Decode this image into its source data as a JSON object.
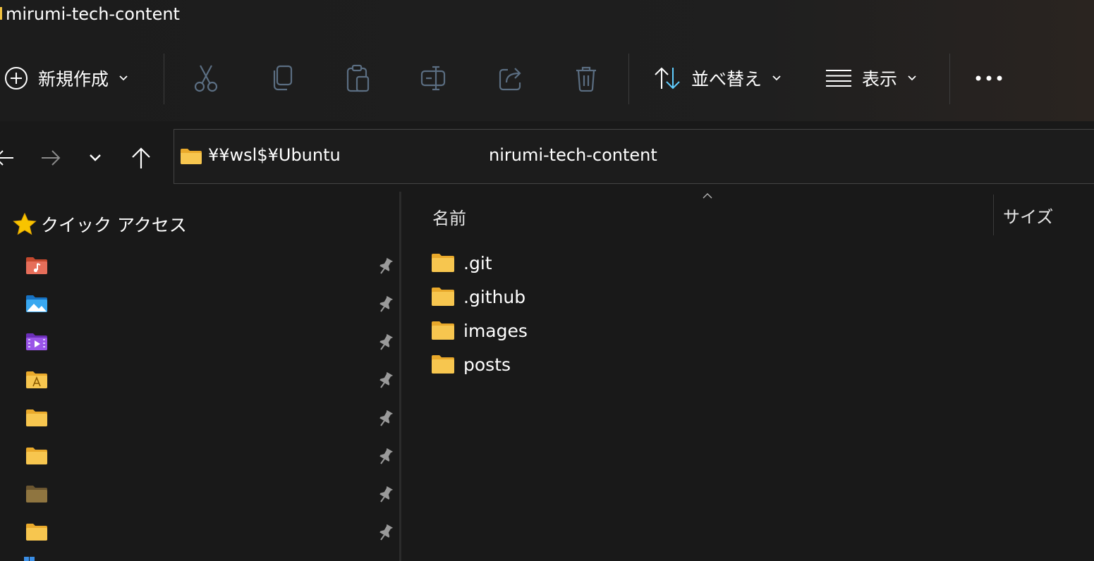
{
  "window": {
    "title": "mirumi-tech-content"
  },
  "toolbar": {
    "new_label": "新規作成",
    "sort_label": "並べ替え",
    "view_label": "表示",
    "icons": [
      "cut-icon",
      "copy-icon",
      "paste-icon",
      "rename-icon",
      "share-icon",
      "delete-icon"
    ]
  },
  "address": {
    "path": "¥¥wsl$¥Ubuntu",
    "current": "nirumi-tech-content"
  },
  "sidebar": {
    "quick_access_label": "クイック アクセス",
    "items": [
      {
        "icon": "music-folder-icon"
      },
      {
        "icon": "pictures-folder-icon"
      },
      {
        "icon": "videos-folder-icon"
      },
      {
        "icon": "font-folder-icon"
      },
      {
        "icon": "folder-icon"
      },
      {
        "icon": "folder-icon"
      },
      {
        "icon": "dark-folder-icon"
      },
      {
        "icon": "folder-icon"
      }
    ]
  },
  "list": {
    "columns": {
      "name": "名前",
      "size": "サイズ"
    },
    "rows": [
      {
        "name": ".git"
      },
      {
        "name": ".github"
      },
      {
        "name": "images"
      },
      {
        "name": "posts"
      }
    ]
  },
  "colors": {
    "accent": "#60cdff",
    "folder": "#f7c64f",
    "background": "#191919"
  }
}
